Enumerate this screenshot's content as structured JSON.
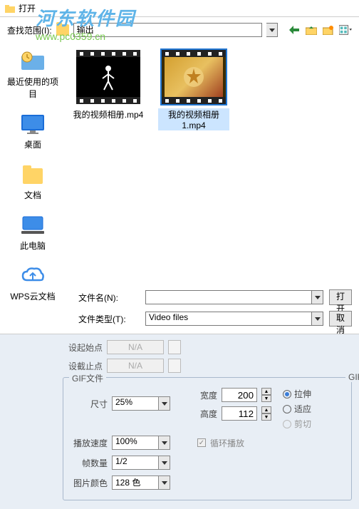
{
  "title": "打开",
  "watermark": {
    "text": "河东软件园",
    "url": "www.pc0359.cn"
  },
  "search": {
    "label": "查找范围(I):",
    "value": "输出"
  },
  "sidebar": {
    "items": [
      {
        "label": "最近使用的项目",
        "name": "recent"
      },
      {
        "label": "桌面",
        "name": "desktop"
      },
      {
        "label": "文档",
        "name": "documents"
      },
      {
        "label": "此电脑",
        "name": "this-pc"
      },
      {
        "label": "WPS云文档",
        "name": "wps-cloud"
      }
    ]
  },
  "files": [
    {
      "name": "我的视频相册.mp4",
      "selected": false
    },
    {
      "name": "我的视频相册1.mp4",
      "selected": true
    }
  ],
  "fields": {
    "filename_label": "文件名(N):",
    "filename_value": "",
    "filetype_label": "文件类型(T):",
    "filetype_value": "Video files",
    "open_btn": "打开",
    "cancel_btn": "取消"
  },
  "setpoints": {
    "start_label": "设起始点",
    "start_value": "N/A",
    "end_label": "设截止点",
    "end_value": "N/A"
  },
  "gif": {
    "legend": "GIF文件",
    "gi_label": "GIF",
    "size_label": "尺寸",
    "size_value": "25%",
    "width_label": "宽度",
    "width_value": "200",
    "height_label": "高度",
    "height_value": "112",
    "speed_label": "播放速度",
    "speed_value": "100%",
    "frames_label": "帧数量",
    "frames_value": "1/2",
    "colors_label": "图片颜色",
    "colors_value": "128 色",
    "loop_label": "循环播放",
    "radios": {
      "stretch": "拉伸",
      "fit": "适应",
      "crop": "剪切"
    }
  }
}
